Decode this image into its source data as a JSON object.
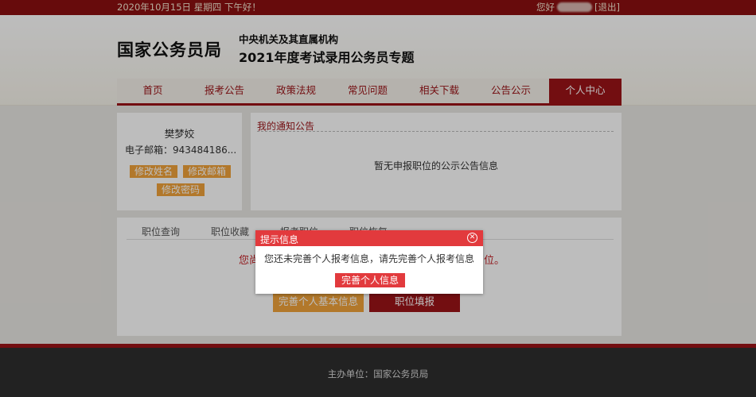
{
  "topbar": {
    "date": "2020年10月15日  星期四  下午好！",
    "greeting": "您好",
    "logout": "[退出]"
  },
  "header": {
    "logo": "国家公务员局",
    "subtitle1": "中央机关及其直属机构",
    "subtitle2": "2021年度考试录用公务员专题"
  },
  "nav": {
    "items": [
      {
        "label": "首页"
      },
      {
        "label": "报考公告"
      },
      {
        "label": "政策法规"
      },
      {
        "label": "常见问题"
      },
      {
        "label": "相关下载"
      },
      {
        "label": "公告公示"
      },
      {
        "label": "个人中心"
      }
    ],
    "active_index": 6
  },
  "user": {
    "name": "樊梦姣",
    "email": "电子邮箱：943484186...",
    "edit_name": "修改姓名",
    "edit_email": "修改邮箱",
    "edit_password": "修改密码"
  },
  "notices": {
    "title": "我的通知公告",
    "empty": "暂无申报职位的公示公告信息"
  },
  "jobs": {
    "tabs": [
      {
        "label": "职位查询"
      },
      {
        "label": "职位收藏"
      },
      {
        "label": "报考职位"
      },
      {
        "label": "职位恢复"
      }
    ],
    "warning_left": "您尚",
    "warning_right": "位。",
    "complete_basic": "完善个人基本信息",
    "fill_position": "职位填报"
  },
  "modal": {
    "title": "提示信息",
    "message": "您还未完善个人报考信息，请先完善个人报考信息",
    "button": "完善个人信息"
  },
  "footer": {
    "text": "主办单位：国家公务员局"
  },
  "colors": {
    "brand_red": "#9b1418",
    "modal_red": "#e23a3d",
    "accent_orange": "#f0a33b"
  }
}
